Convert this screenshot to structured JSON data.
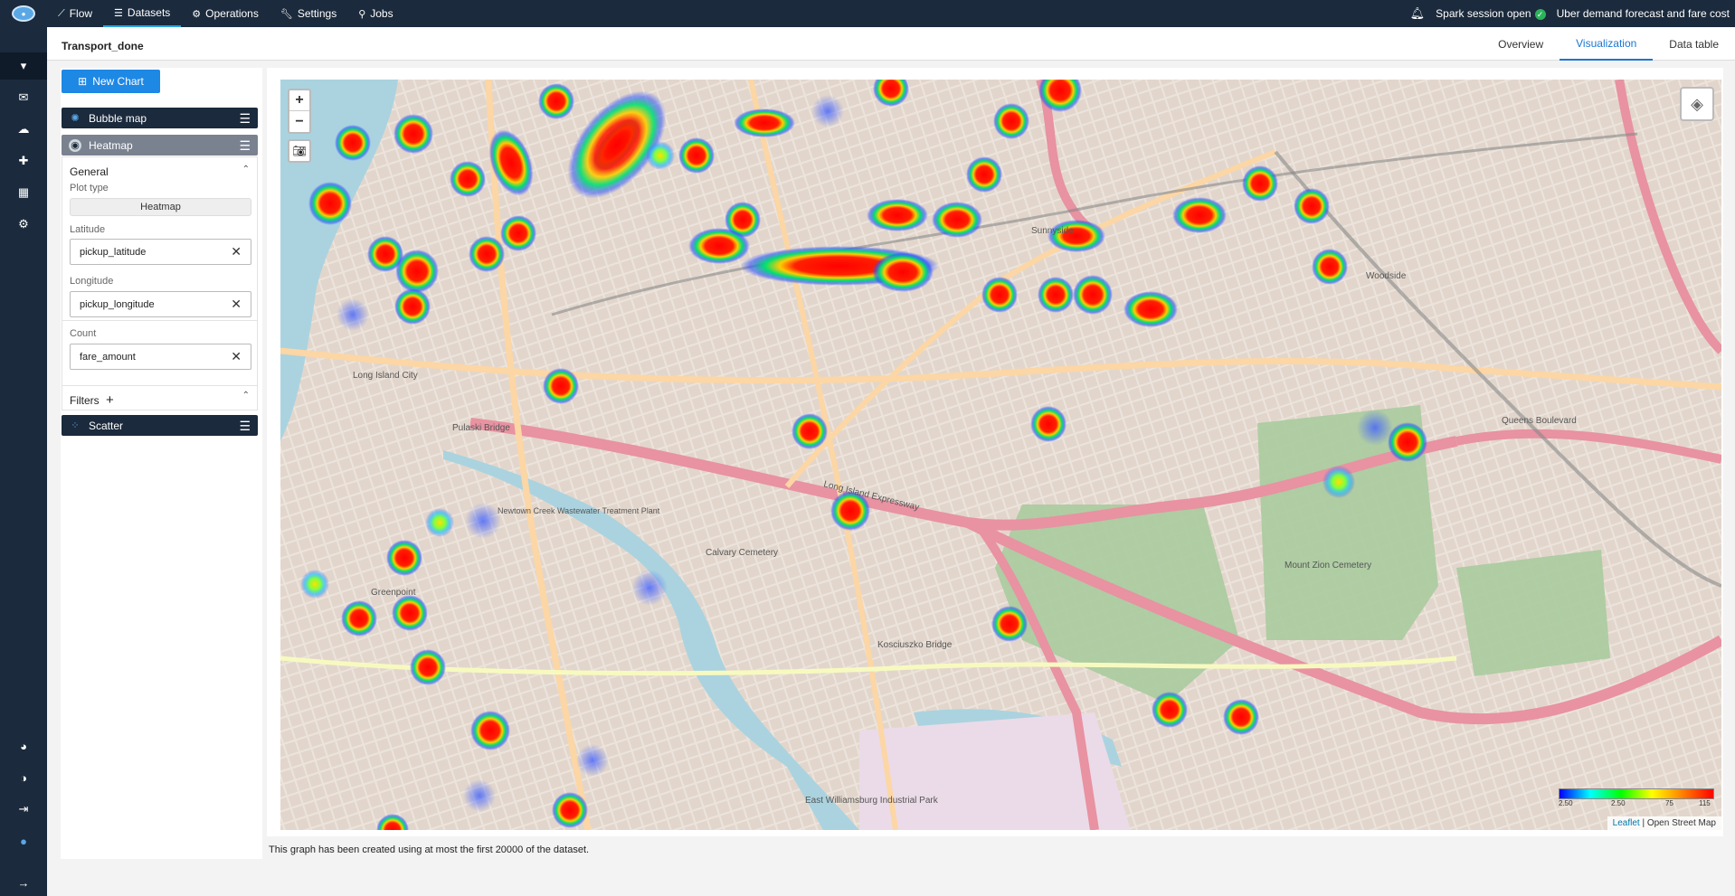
{
  "app": {
    "logo_icon": "app-logo-icon",
    "nav": [
      {
        "label": "Flow",
        "icon": "chart-line-icon",
        "active": false
      },
      {
        "label": "Datasets",
        "icon": "list-icon",
        "active": true
      },
      {
        "label": "Operations",
        "icon": "gear-icon",
        "active": false
      },
      {
        "label": "Settings",
        "icon": "wrench-icon",
        "active": false
      },
      {
        "label": "Jobs",
        "icon": "jobs-icon",
        "active": false
      }
    ],
    "status_text": "Spark session open",
    "project_name": "Uber demand forecast and fare cost"
  },
  "sidebar": {
    "items": [
      "chevron-down-icon",
      "inbox-icon",
      "cloud-upload-icon",
      "puzzle-icon",
      "chart-icon",
      "gear-icon"
    ],
    "bottom_items": [
      "palette-icon",
      "contrast-icon",
      "logout-icon",
      "info-icon",
      "arrow-right-icon"
    ]
  },
  "dataset": {
    "title": "Transport_done",
    "tabs": [
      {
        "label": "Overview",
        "active": false
      },
      {
        "label": "Visualization",
        "active": true
      },
      {
        "label": "Data table",
        "active": false
      }
    ]
  },
  "panel": {
    "new_chart_label": "New Chart",
    "charts": [
      {
        "label": "Bubble map",
        "icon": "bubble-icon",
        "expanded": false
      },
      {
        "label": "Heatmap",
        "icon": "heatmap-icon",
        "expanded": true
      },
      {
        "label": "Scatter",
        "icon": "scatter-icon",
        "expanded": false
      }
    ],
    "general_label": "General",
    "plot_type_label": "Plot type",
    "plot_type_value": "Heatmap",
    "latitude_label": "Latitude",
    "latitude_value": "pickup_latitude",
    "longitude_label": "Longitude",
    "longitude_value": "pickup_longitude",
    "count_label": "Count",
    "count_value": "fare_amount",
    "filters_label": "Filters"
  },
  "map": {
    "legend_ticks": [
      "2.50",
      "2.50",
      "75",
      "115"
    ],
    "attribution_leaflet": "Leaflet",
    "attribution_osm": "Open Street Map",
    "place_labels": [
      "Calvary Cemetery",
      "Long Island Expressway",
      "Kosciuszko Bridge",
      "Pulaski Bridge",
      "Mount Zion Cemetery",
      "Queens Boulevard",
      "East Williamsburg Industrial Park",
      "Long Island City",
      "Greenpoint",
      "Sunnyside",
      "Woodside",
      "Newtown Creek Wastewater Treatment Plant"
    ]
  },
  "caption": "This graph has been created using at most the first 20000 of the dataset."
}
